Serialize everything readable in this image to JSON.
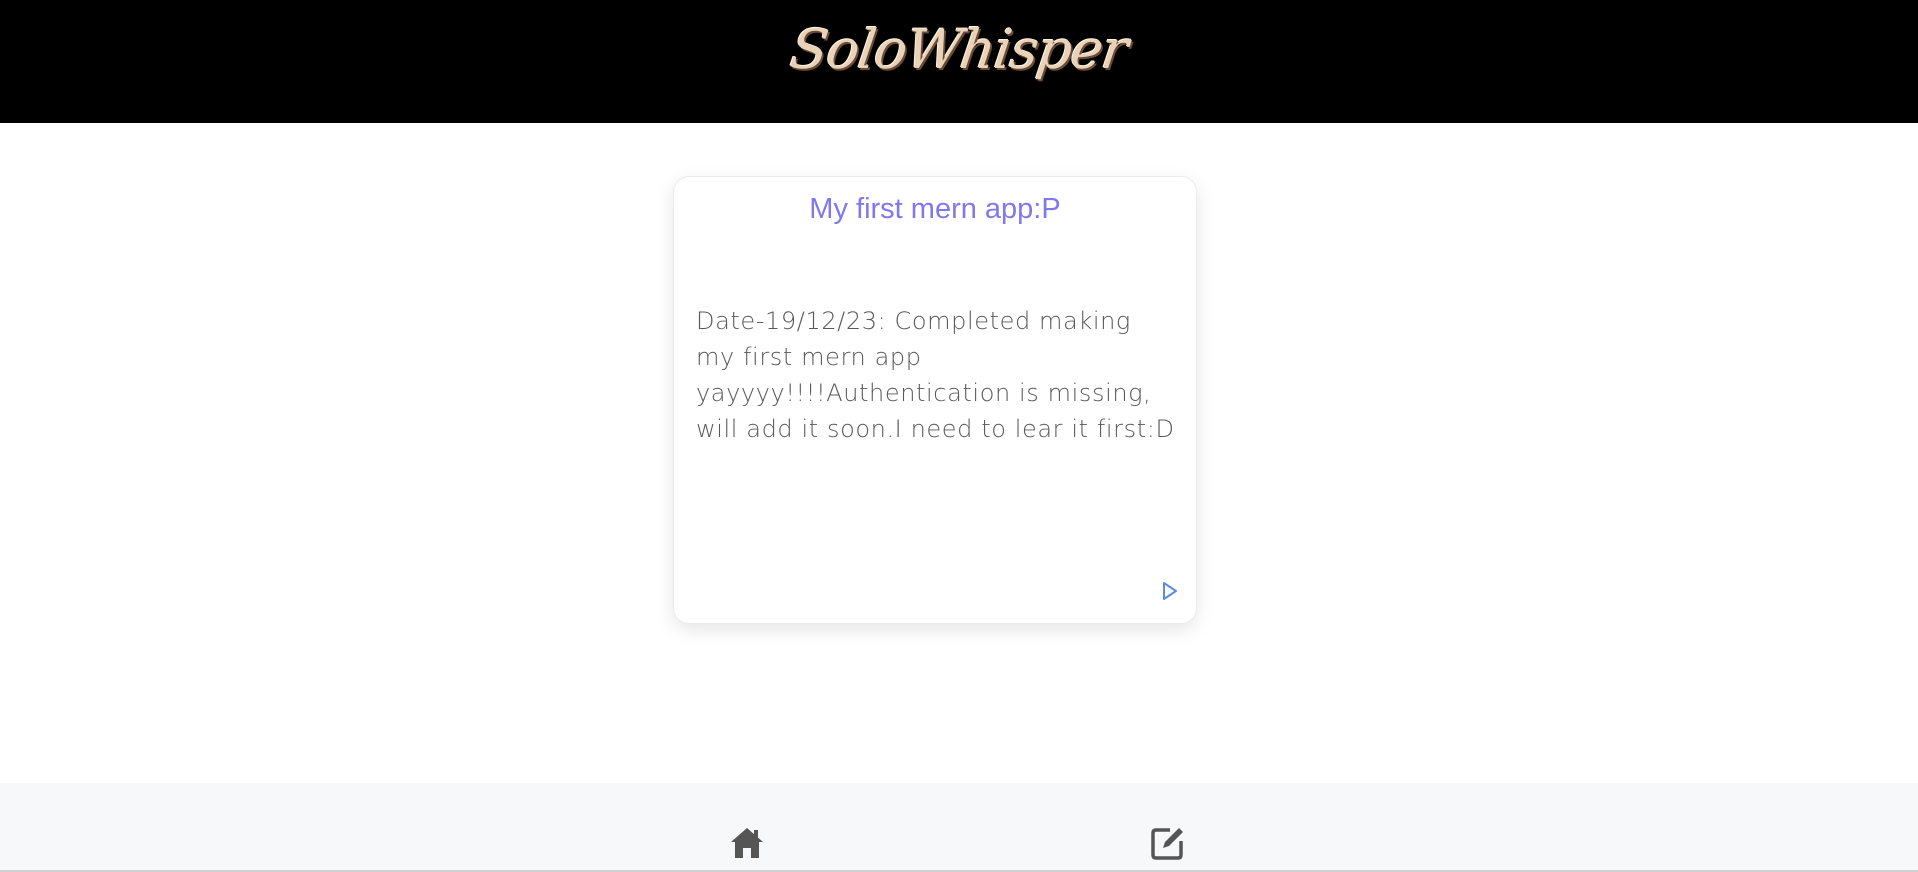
{
  "header": {
    "logo_text": "SoloWhisper"
  },
  "entry_card": {
    "title": "My first mern app:P",
    "body": "Date-19/12/23: Completed making my first mern app yayyyy!!!!Authentication is missing, will add it soon.I need to lear it first:D",
    "action_icon": "play-triangle-icon"
  },
  "footer": {
    "home_icon": "home-icon",
    "compose_icon": "edit-icon"
  },
  "colors": {
    "header_bg": "#000000",
    "title": "#7f78f0",
    "body_text": "#595959",
    "action": "#5b8be8",
    "footer_bg": "#f7f8fa",
    "footer_icons": "#555555"
  }
}
